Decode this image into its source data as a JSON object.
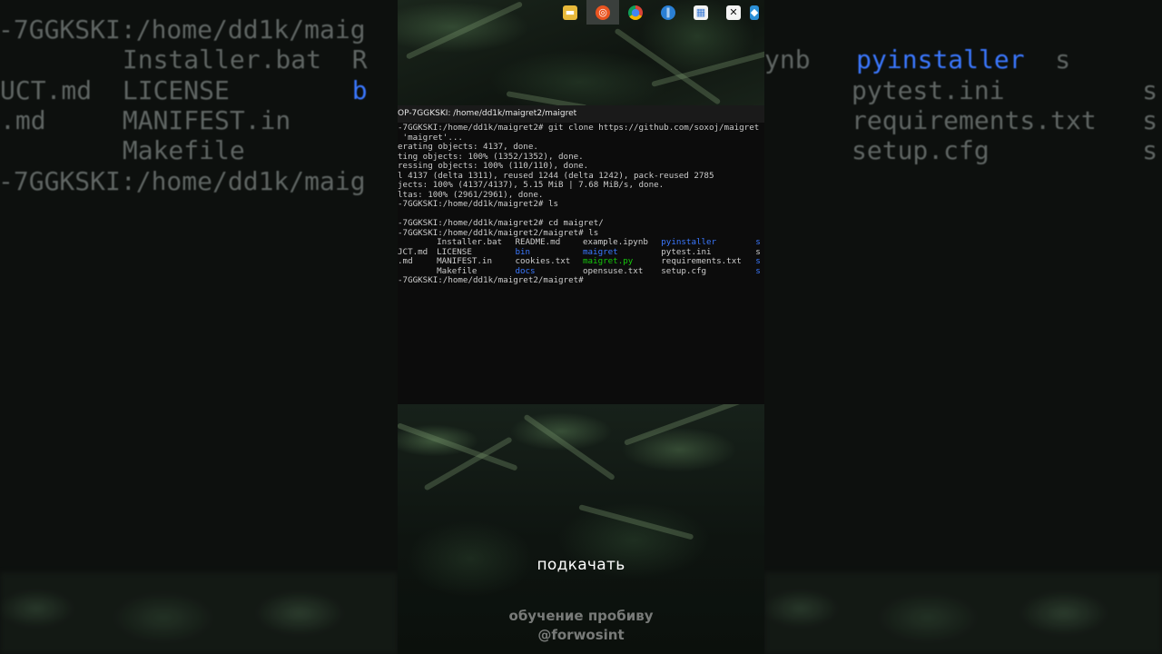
{
  "background_left_lines": [
    {
      "text": "-7GGKSKI:/home/dd1k/maig"
    },
    {
      "text": "        Installer.bat  R"
    },
    {
      "text": "UCT.md  LICENSE        ",
      "extra": "b"
    },
    {
      "text": ".md     MANIFEST.in"
    },
    {
      "text": "        Makefile"
    },
    {
      "text": "-7GGKSKI:/home/dd1k/maig"
    }
  ],
  "background_right_lines": [
    {
      "a": "ynb   ",
      "b": "pyinstaller",
      "c": "  s"
    },
    {
      "a": "      ",
      "b": "",
      "c": "pytest.ini         s"
    },
    {
      "a": "      ",
      "b": "",
      "c": "requirements.txt   s"
    },
    {
      "a": "      ",
      "b": "",
      "c": "setup.cfg          s"
    }
  ],
  "tray": {
    "icons": [
      {
        "name": "file-explorer-icon",
        "color": "#e8b93a",
        "glyph": "▬"
      },
      {
        "name": "ubuntu-icon",
        "color": "#e95420",
        "glyph": "◎"
      },
      {
        "name": "chrome-icon",
        "color": "#4285f4",
        "glyph": "●"
      },
      {
        "name": "audio-app-icon",
        "color": "#2a7fd4",
        "glyph": "∥"
      },
      {
        "name": "store-icon",
        "color": "#f4f4f4",
        "glyph": "▦"
      },
      {
        "name": "capcut-icon",
        "color": "#111111",
        "glyph": "✕"
      },
      {
        "name": "app-icon",
        "color": "#2b8fd6",
        "glyph": "◆"
      }
    ]
  },
  "terminal": {
    "title": "OP-7GGKSKI: /home/dd1k/maigret2/maigret",
    "lines": [
      "-7GGKSKI:/home/dd1k/maigret2# git clone https://github.com/soxoj/maigret",
      " 'maigret'...",
      "erating objects: 4137, done.",
      "ting objects: 100% (1352/1352), done.",
      "ressing objects: 100% (110/110), done.",
      "l 4137 (delta 1311), reused 1244 (delta 1242), pack-reused 2785",
      "jects: 100% (4137/4137), 5.15 MiB | 7.68 MiB/s, done.",
      "ltas: 100% (2961/2961), done.",
      "-7GGKSKI:/home/dd1k/maigret2# ls",
      "",
      "-7GGKSKI:/home/dd1k/maigret2# cd maigret/",
      "-7GGKSKI:/home/dd1k/maigret2/maigret# ls"
    ],
    "ls_rows": [
      [
        "",
        "Installer.bat",
        "README.md",
        "example.ipynb",
        "pyinstaller",
        "s"
      ],
      [
        "JCT.md",
        "LICENSE",
        "bin",
        "maigret",
        "pytest.ini",
        "s"
      ],
      [
        ".md",
        "MANIFEST.in",
        "cookies.txt",
        "maigret.py",
        "requirements.txt",
        "s"
      ],
      [
        "",
        "Makefile",
        "docs",
        "opensuse.txt",
        "setup.cfg",
        "s"
      ]
    ],
    "ls_colors": [
      [
        "",
        "",
        "",
        "",
        "blue",
        "blue"
      ],
      [
        "",
        "",
        "blue",
        "blue",
        "",
        ""
      ],
      [
        "",
        "",
        "",
        "green",
        "",
        "blue"
      ],
      [
        "",
        "",
        "blue",
        "",
        "",
        "blue"
      ]
    ],
    "final_prompt": "-7GGKSKI:/home/dd1k/maigret2/maigret#"
  },
  "captions": {
    "subtitle": "подкачать",
    "watermark_line1": "обучение пробиву",
    "watermark_line2": "@forwosint"
  }
}
